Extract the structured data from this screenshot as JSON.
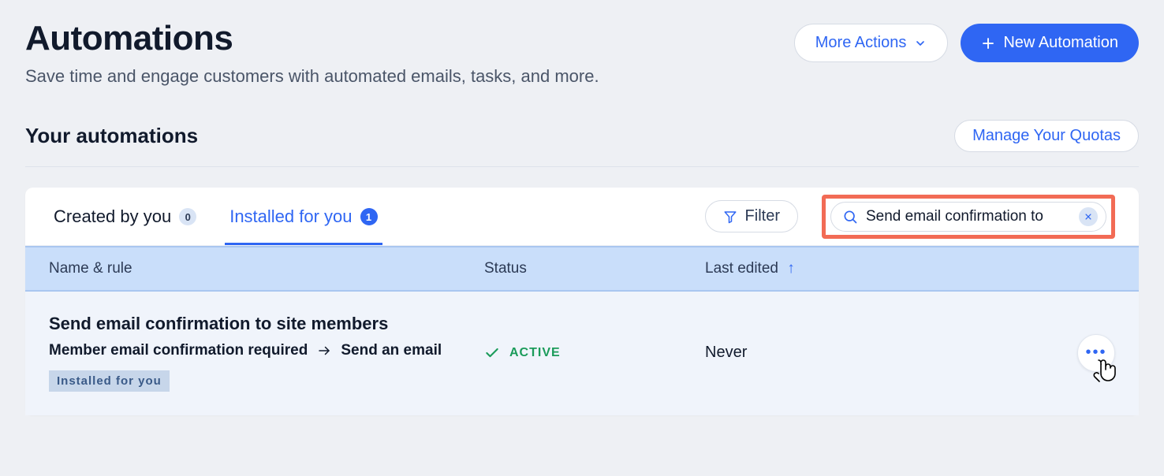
{
  "header": {
    "title": "Automations",
    "subtitle": "Save time and engage customers with automated emails, tasks, and more.",
    "more_actions_label": "More Actions",
    "new_automation_label": "New Automation"
  },
  "subheader": {
    "title": "Your automations",
    "manage_quotas_label": "Manage Your Quotas"
  },
  "tabs": {
    "created": {
      "label": "Created by you",
      "count": "0"
    },
    "installed": {
      "label": "Installed for you",
      "count": "1"
    }
  },
  "toolbar": {
    "filter_label": "Filter",
    "search_value": "Send email confirmation to"
  },
  "columns": {
    "name": "Name & rule",
    "status": "Status",
    "edited": "Last edited"
  },
  "rows": [
    {
      "title": "Send email confirmation to site members",
      "trigger": "Member email confirmation required",
      "action": "Send an email",
      "status": "ACTIVE",
      "edited": "Never",
      "tag": "Installed for you"
    }
  ]
}
